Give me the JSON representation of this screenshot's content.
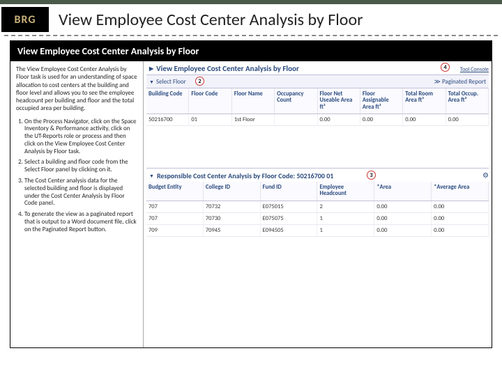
{
  "logo": "BRG",
  "title": "View Employee Cost Center Analysis by Floor",
  "subtitle": "View Employee Cost Center Analysis by Floor",
  "description": "The View Employee Cost Center Analysis by Floor task is used for an understanding of space allocation to cost centers at the building and floor level and allows you to see the employee headcount per building and floor and the total occupied area per building.",
  "steps": [
    "On the Process Navigator, click on the Space Inventory & Performance activity, click on the UT-Reports role or process and then click on the View Employee Cost Center Analysis by Floor task.",
    "Select a building and floor code from the Select Floor panel by clicking on it.",
    "The Cost Center analysis data for the selected building and floor is displayed under the Cost Center Analysis by Floor Code panel.",
    "To generate the view as a paginated report that is output to a Word document file, click on the Paginated Report button."
  ],
  "panel_title": "View Employee Cost Center Analysis by Floor",
  "tool_console": "Tool Console",
  "select_floor": "Select Floor",
  "paginated": "Paginated Report",
  "grid1": {
    "headers": [
      "Building Code",
      "Floor Code",
      "Floor Name",
      "Occupancy Count",
      "Floor Net Useable Area ft²",
      "Floor Assignable Area ft²",
      "Total Room Area ft²",
      "Total Occup. Area ft²"
    ],
    "rows": [
      [
        "50216700",
        "01",
        "1st Floor",
        "",
        "0.00",
        "0.00",
        "0.00",
        "0.00"
      ]
    ]
  },
  "sub_panel": "Responsible Cost Center Analysis by Floor Code: 50216700 01",
  "grid2": {
    "headers": [
      "Budget Entity",
      "College ID",
      "Fund ID",
      "Employee Headcount",
      "*Area",
      "*Average Area"
    ],
    "rows": [
      [
        "707",
        "70732",
        "E075015",
        "",
        "2",
        "0.00",
        "0.00"
      ],
      [
        "707",
        "70730",
        "E075075",
        "",
        "1",
        "0.00",
        "0.00"
      ],
      [
        "709",
        "70945",
        "E094505",
        "",
        "1",
        "0.00",
        "0.00"
      ]
    ]
  },
  "callouts": {
    "c2": "2",
    "c3": "3",
    "c4": "4"
  }
}
